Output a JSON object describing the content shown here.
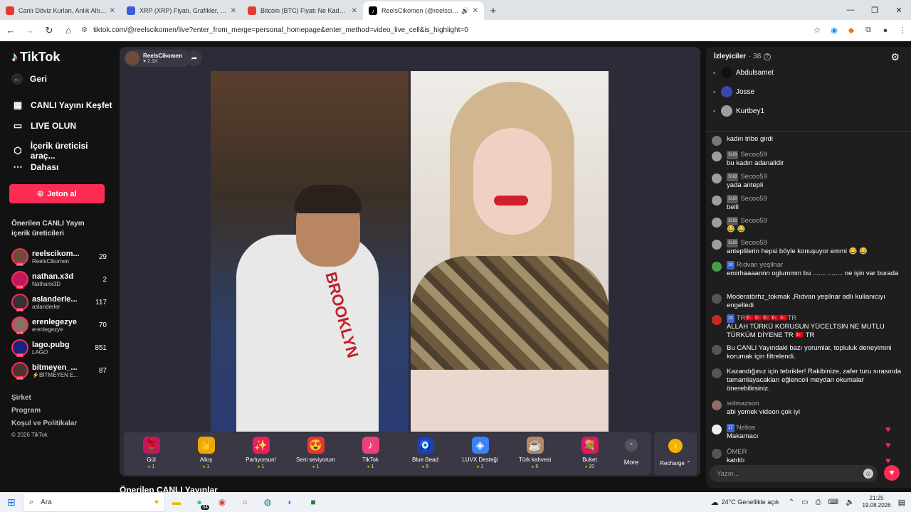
{
  "browser": {
    "tabs": [
      {
        "title": "Canlı Döviz Kurları, Anlık Altın F",
        "icon": "chart-favicon",
        "active": false,
        "color": "#e53935"
      },
      {
        "title": "XRP (XRP) Fiyatı, Grafikler, Piyas",
        "icon": "coin-favicon",
        "active": false,
        "color": "#3c5bd6"
      },
      {
        "title": "Bitcoin (BTC) Fiyatı Ne Kadar? C",
        "icon": "chart-favicon",
        "active": false,
        "color": "#e53935"
      },
      {
        "title": "ReelsCikomen (@reelscikom",
        "icon": "tiktok-favicon",
        "active": true,
        "color": "#000000"
      }
    ],
    "url": "tiktok.com/@reelscikomen/live?enter_from_merge=personal_homepage&enter_method=video_live_cell&is_highlight=0"
  },
  "sidebar": {
    "logo": "TikTok",
    "back": "Geri",
    "menu": [
      {
        "label": "CANLI Yayını Keşfet",
        "icon": "live-explore-icon"
      },
      {
        "label": "LIVE OLUN",
        "icon": "camera-icon"
      },
      {
        "label": "İçerik üreticisi araç...",
        "icon": "creator-tools-icon"
      },
      {
        "label": "Dahası",
        "icon": "more-dots-icon"
      }
    ],
    "jeton": "Jeton al",
    "section_title": "Önerilen CANLI Yayın içerik üreticileri",
    "creators": [
      {
        "name": "reelscikom...",
        "handle": "ReelsCikomen",
        "count": "29",
        "color": "#6b4c3d"
      },
      {
        "name": "nathan.x3d",
        "handle": "Nathanx3D",
        "count": "2",
        "color": "#c2185b"
      },
      {
        "name": "aslanderle...",
        "handle": "aslanderler",
        "count": "117",
        "color": "#333333"
      },
      {
        "name": "erenlegezye",
        "handle": "erenlegezye",
        "count": "70",
        "color": "#8d6e63"
      },
      {
        "name": "lago.pubg",
        "handle": "LAGO",
        "count": "851",
        "color": "#1a237e"
      },
      {
        "name": "bitmeyen_...",
        "handle": "⚡BİTMEYEN E...",
        "count": "87",
        "color": "#4e342e"
      }
    ],
    "footer": [
      "Şirket",
      "Program",
      "Koşul ve Politikalar",
      "© 2026 TikTok"
    ]
  },
  "stream": {
    "host_name": "ReelsCikomen",
    "host_likes": "♥ 2.1K",
    "video_text": "BROOKLYN",
    "gifts": [
      {
        "name": "Gül",
        "price": "1",
        "icon": "rose-icon",
        "glyph": "🌹",
        "bg": "#c2185b"
      },
      {
        "name": "Alkış",
        "price": "1",
        "icon": "clap-icon",
        "glyph": "👏",
        "bg": "#f0a500"
      },
      {
        "name": "Parlıyorsun!",
        "price": "1",
        "icon": "shine-icon",
        "glyph": "✨",
        "bg": "#e91e63"
      },
      {
        "name": "Seni seviyorum",
        "price": "1",
        "icon": "love-icon",
        "glyph": "😍",
        "bg": "#e53935"
      },
      {
        "name": "TikTok",
        "price": "1",
        "icon": "tiktok-gift-icon",
        "glyph": "♪",
        "bg": "#ec407a"
      },
      {
        "name": "Blue Bead",
        "price": "5",
        "icon": "blue-bead-icon",
        "glyph": "🧿",
        "bg": "#1e40af"
      },
      {
        "name": "LUVX Desteği",
        "price": "1",
        "icon": "luvx-icon",
        "glyph": "◈",
        "bg": "#3b82f6"
      },
      {
        "name": "Türk kahvesi",
        "price": "5",
        "icon": "coffee-icon",
        "glyph": "☕",
        "bg": "#b08968"
      },
      {
        "name": "Buket",
        "price": "20",
        "icon": "bouquet-icon",
        "glyph": "💐",
        "bg": "#d81b60"
      }
    ],
    "more_label": "More",
    "recharge_label": "Recharge ⌃",
    "suggest_title": "Önerilen CANLI Yayınlar"
  },
  "chat": {
    "viewers_label": "İzleyiciler",
    "viewers_count": "· 38",
    "top_viewers": [
      {
        "name": "Abdulsamet",
        "color": "#111111"
      },
      {
        "name": "Josse",
        "color": "#3949ab"
      },
      {
        "name": "Kurtbey1",
        "color": "#9e9e9e"
      }
    ],
    "messages": [
      {
        "user": "",
        "tag": "",
        "text": "kadın tribe girdi",
        "color": "#777777"
      },
      {
        "user": "Secoo59",
        "tag": "SUB",
        "text": "bu kadın adanalidir",
        "color": "#9e9e9e"
      },
      {
        "user": "Secoo59",
        "tag": "SUB",
        "text": "yada antepli",
        "color": "#9e9e9e"
      },
      {
        "user": "Secoo59",
        "tag": "SUB",
        "text": "belli",
        "color": "#9e9e9e"
      },
      {
        "user": "Secoo59",
        "tag": "SUB",
        "text": "😂 😂",
        "color": "#9e9e9e"
      },
      {
        "user": "Secoo59",
        "tag": "SUB",
        "text": "anteplilerin hepsi böyle konuşuyor emmi 😂 😂",
        "color": "#9e9e9e"
      },
      {
        "user": "Rıdvan yeşilnar",
        "tag": "10",
        "text": "emirhaaaannn oglummm bu ....... ........ ne işin var burada",
        "color": "#43a047"
      },
      {
        "user": "",
        "tag": "",
        "text": "Moderatörhz_tokmak ,Rıdvan yeşilnar adlı kullanıcıyı engelledi",
        "color": "#555555"
      },
      {
        "user": "TR🇹🇷🇹🇷🇹🇷🇹🇷🇹🇷TR",
        "tag": "10",
        "text": "ALLAH TÜRKÜ KORUSUN YÜCELTSIN NE MUTLU TÜRKÜM DİYENE TR 🇹🇷 TR",
        "color": "#c62828"
      },
      {
        "user": "",
        "tag": "",
        "text": "Bu CANLI Yayındaki bazı yorumlar, topluluk deneyimini korumak için filtrelendi.",
        "color": "#555555"
      },
      {
        "user": "",
        "tag": "",
        "text": "Kazandığınız için tebrikler! Rakibinize, zafer turu sırasında tamamlayacakları eğlenceli meydan okumalar önerebilirsiniz.",
        "color": "#555555"
      },
      {
        "user": "solmazson",
        "tag": "",
        "text": "abi yemek videon çok iyi",
        "color": "#8d6e63"
      },
      {
        "user": "Nelios",
        "tag": "17",
        "text": "Makarnacı",
        "color": "#eeeeee"
      },
      {
        "user": "ÖMER",
        "tag": "",
        "text": "katıldı",
        "color": "#555555"
      }
    ],
    "input_placeholder": "Yazın..."
  },
  "taskbar": {
    "search": "Ara",
    "badge": "34",
    "weather": "24°C  Genellikle açık",
    "time": "21:25",
    "date": "19.08.2026"
  }
}
